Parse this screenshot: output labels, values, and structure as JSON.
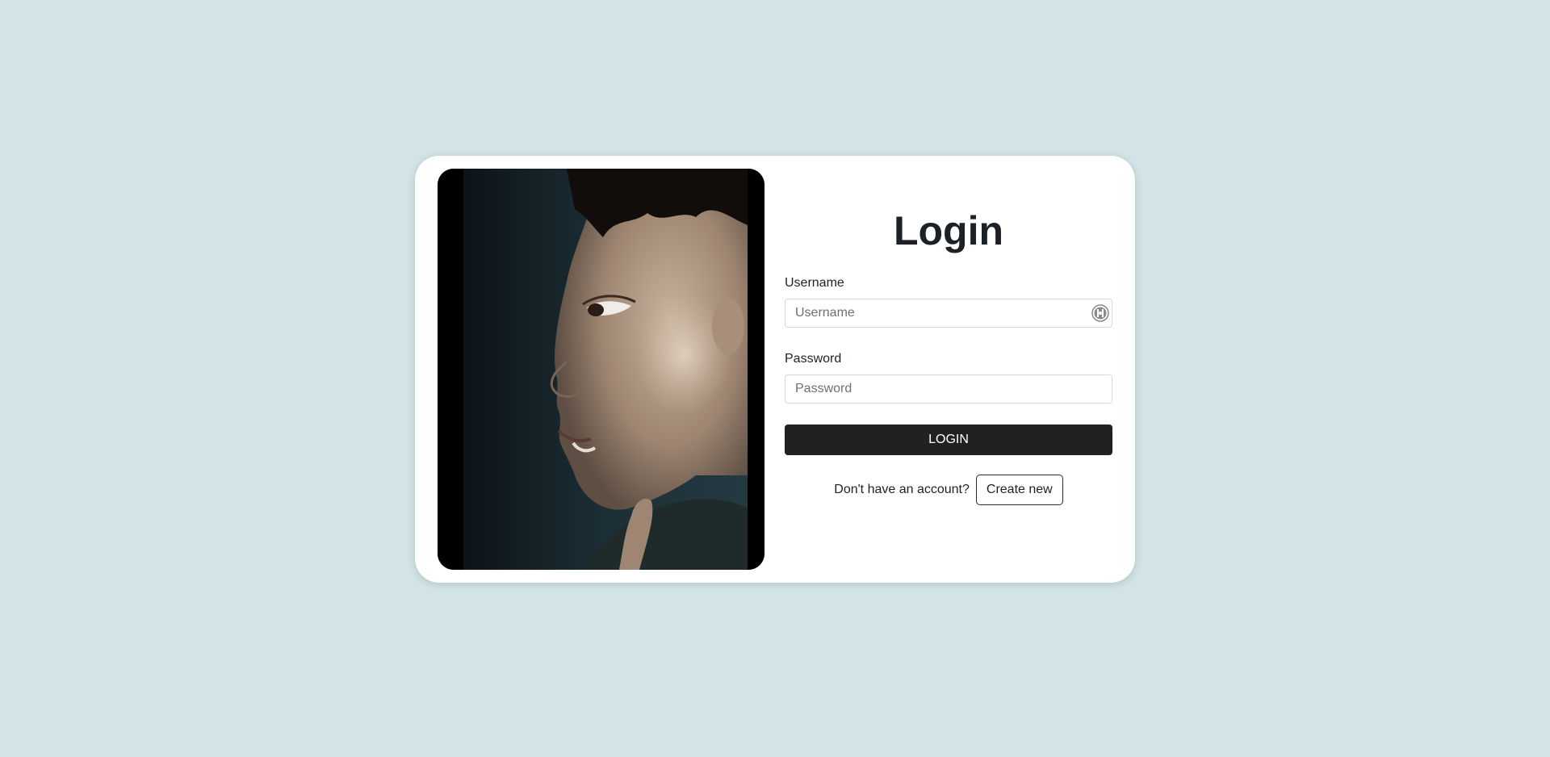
{
  "login": {
    "title": "Login",
    "username_label": "Username",
    "username_placeholder": "Username",
    "username_value": "",
    "password_label": "Password",
    "password_placeholder": "Password",
    "password_value": "",
    "login_button": "LOGIN",
    "signup_prompt": "Don't have an account?",
    "create_button": "Create new"
  },
  "image": {
    "description_icon": "profile-photo"
  },
  "colors": {
    "background": "#d2e4e7",
    "card": "#ffffff",
    "button": "#212121",
    "text": "#1c2127"
  }
}
